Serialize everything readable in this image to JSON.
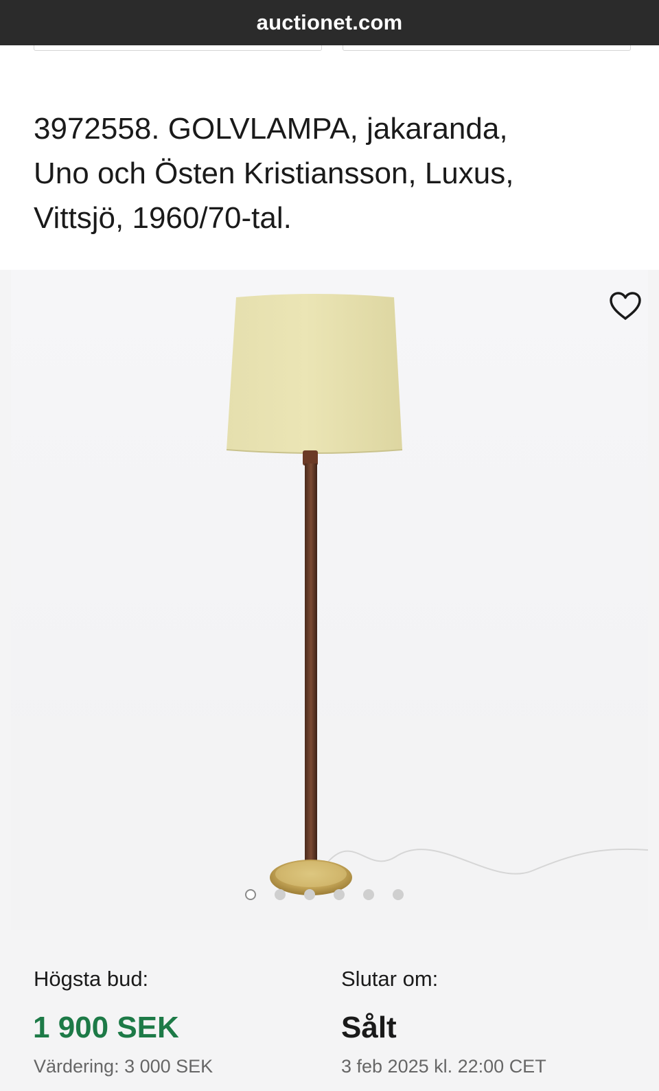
{
  "browser": {
    "domain": "auctionet.com"
  },
  "item": {
    "title_lines": [
      "3972558. GOLVLAMPA, jakaranda,",
      "Uno och Östen Kristiansson, Luxus,",
      "Vittsjö, 1960/70-tal."
    ]
  },
  "gallery": {
    "image_icon": "floor-lamp-photo",
    "favorite_icon": "heart-outline-icon",
    "image_count": 6,
    "active_index": 0
  },
  "bid": {
    "label": "Högsta bud:",
    "amount": "1 900 SEK",
    "estimate": "Värdering: 3 000 SEK"
  },
  "ending": {
    "label": "Slutar om:",
    "status": "Sålt",
    "date": "3 feb 2025 kl. 22:00 CET"
  },
  "colors": {
    "accent_green": "#1d7a47",
    "top_bar": "#2b2b2b"
  }
}
